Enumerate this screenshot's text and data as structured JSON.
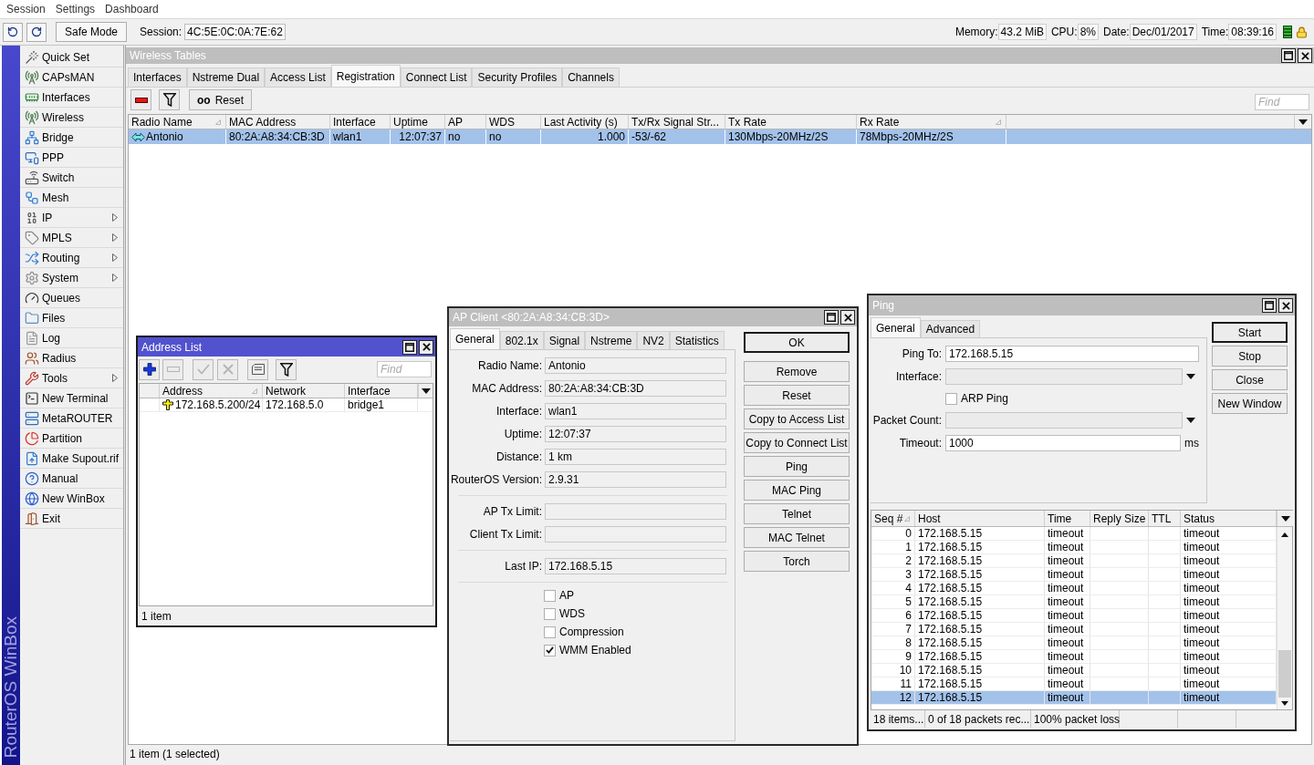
{
  "menu_bar": {
    "items": [
      "Session",
      "Settings",
      "Dashboard"
    ]
  },
  "toolbar": {
    "safe_mode": "Safe Mode",
    "session_label": "Session:",
    "session_value": "4C:5E:0C:0A:7E:62",
    "stats": [
      {
        "label": "Memory:",
        "value": "43.2 MiB"
      },
      {
        "label": "CPU:",
        "value": "8%"
      },
      {
        "label": "Date:",
        "value": "Dec/01/2017"
      },
      {
        "label": "Time:",
        "value": "08:39:16"
      }
    ]
  },
  "brand": "RouterOS WinBox",
  "sidebar": {
    "items": [
      {
        "label": "Quick Set",
        "submenu": false
      },
      {
        "label": "CAPsMAN",
        "submenu": false
      },
      {
        "label": "Interfaces",
        "submenu": false
      },
      {
        "label": "Wireless",
        "submenu": false
      },
      {
        "label": "Bridge",
        "submenu": false
      },
      {
        "label": "PPP",
        "submenu": false
      },
      {
        "label": "Switch",
        "submenu": false
      },
      {
        "label": "Mesh",
        "submenu": false
      },
      {
        "label": "IP",
        "submenu": true
      },
      {
        "label": "MPLS",
        "submenu": true
      },
      {
        "label": "Routing",
        "submenu": true
      },
      {
        "label": "System",
        "submenu": true
      },
      {
        "label": "Queues",
        "submenu": false
      },
      {
        "label": "Files",
        "submenu": false
      },
      {
        "label": "Log",
        "submenu": false
      },
      {
        "label": "Radius",
        "submenu": false
      },
      {
        "label": "Tools",
        "submenu": true
      },
      {
        "label": "New Terminal",
        "submenu": false
      },
      {
        "label": "MetaROUTER",
        "submenu": false
      },
      {
        "label": "Partition",
        "submenu": false
      },
      {
        "label": "Make Supout.rif",
        "submenu": false
      },
      {
        "label": "Manual",
        "submenu": false
      },
      {
        "label": "New WinBox",
        "submenu": false
      },
      {
        "label": "Exit",
        "submenu": false
      }
    ]
  },
  "wireless_tables": {
    "title": "Wireless Tables",
    "active": false,
    "tabs": [
      {
        "label": "Interfaces",
        "selected": false
      },
      {
        "label": "Nstreme Dual",
        "selected": false
      },
      {
        "label": "Access List",
        "selected": false
      },
      {
        "label": "Registration",
        "selected": true
      },
      {
        "label": "Connect List",
        "selected": false
      },
      {
        "label": "Security Profiles",
        "selected": false
      },
      {
        "label": "Channels",
        "selected": false
      }
    ],
    "toolbar": [
      {
        "kind": "remove",
        "disabled": false
      },
      {
        "kind": "filter",
        "disabled": false
      }
    ],
    "reset": {
      "glyph": "oo",
      "label": "Reset"
    },
    "find": {
      "placeholder": "Find"
    },
    "table": {
      "columns": [
        {
          "label": "Radio Name",
          "kind": "text",
          "sorted": true
        },
        {
          "label": "MAC Address",
          "kind": "text",
          "sorted": false
        },
        {
          "label": "Interface",
          "kind": "text",
          "sorted": false
        },
        {
          "label": "Uptime",
          "kind": "number",
          "sorted": false
        },
        {
          "label": "AP",
          "kind": "text",
          "sorted": false
        },
        {
          "label": "WDS",
          "kind": "text",
          "sorted": false
        },
        {
          "label": "Last Activity (s)",
          "kind": "number",
          "sorted": false
        },
        {
          "label": "Tx/Rx Signal Str...",
          "kind": "text",
          "sorted": false
        },
        {
          "label": "Tx Rate",
          "kind": "text",
          "sorted": false
        },
        {
          "label": "Rx Rate",
          "kind": "text",
          "sorted": true
        }
      ],
      "rows": [
        {
          "selected": true,
          "cells": [
            "Antonio",
            "80:2A:A8:34:CB:3D",
            "wlan1",
            "12:07:37",
            "no",
            "no",
            "1.000",
            "-53/-62",
            "130Mbps-20MHz/2S",
            "78Mbps-20MHz/2S"
          ]
        }
      ]
    },
    "status": "1 item (1 selected)"
  },
  "address_list": {
    "title": "Address List",
    "active": true,
    "toolbar": [
      {
        "kind": "add",
        "disabled": false
      },
      {
        "kind": "remove",
        "disabled": true
      },
      {
        "kind": "enable",
        "disabled": true
      },
      {
        "kind": "disable",
        "disabled": true
      },
      {
        "kind": "comment",
        "disabled": false
      },
      {
        "kind": "filter",
        "disabled": false
      }
    ],
    "find": {
      "placeholder": "Find"
    },
    "table": {
      "columns": [
        {
          "label": "Address",
          "sorted": true
        },
        {
          "label": "Network",
          "sorted": false
        },
        {
          "label": "Interface",
          "sorted": false
        }
      ],
      "rows": [
        {
          "selected": false,
          "cells": [
            "172.168.5.200/24",
            "172.168.5.0",
            "bridge1"
          ]
        }
      ]
    },
    "status": "1 item"
  },
  "ap_client": {
    "title": "AP Client <80:2A:A8:34:CB:3D>",
    "active": false,
    "tabs": [
      {
        "label": "General",
        "selected": true
      },
      {
        "label": "802.1x",
        "selected": false
      },
      {
        "label": "Signal",
        "selected": false
      },
      {
        "label": "Nstreme",
        "selected": false
      },
      {
        "label": "NV2",
        "selected": false
      },
      {
        "label": "Statistics",
        "selected": false
      }
    ],
    "sections": [
      {
        "fields": [
          {
            "label": "Radio Name:",
            "value": "Antonio"
          },
          {
            "label": "MAC Address:",
            "value": "80:2A:A8:34:CB:3D"
          },
          {
            "label": "Interface:",
            "value": "wlan1"
          },
          {
            "label": "Uptime:",
            "value": "12:07:37"
          },
          {
            "label": "Distance:",
            "value": "1 km"
          },
          {
            "label": "RouterOS Version:",
            "value": "2.9.31"
          }
        ]
      },
      {
        "fields": [
          {
            "label": "AP Tx Limit:"
          },
          {
            "label": "Client Tx Limit:"
          }
        ]
      },
      {
        "fields": [
          {
            "label": "Last IP:",
            "value": "172.168.5.15"
          }
        ]
      }
    ],
    "checkboxes": [
      {
        "label": "AP",
        "checked": false
      },
      {
        "label": "WDS",
        "checked": false
      },
      {
        "label": "Compression",
        "checked": false
      },
      {
        "label": "WMM Enabled",
        "checked": true
      }
    ],
    "buttons": [
      {
        "label": "OK",
        "default": true
      },
      {
        "label": "Remove",
        "default": false
      },
      {
        "label": "Reset",
        "default": false
      },
      {
        "label": "Copy to Access List",
        "default": false
      },
      {
        "label": "Copy to Connect List",
        "default": false
      },
      {
        "label": "Ping",
        "default": false
      },
      {
        "label": "MAC Ping",
        "default": false
      },
      {
        "label": "Telnet",
        "default": false
      },
      {
        "label": "MAC Telnet",
        "default": false
      },
      {
        "label": "Torch",
        "default": false
      }
    ]
  },
  "ping": {
    "title": "Ping",
    "active": false,
    "tabs": [
      {
        "label": "General",
        "selected": true
      },
      {
        "label": "Advanced",
        "selected": false
      }
    ],
    "fields": [
      {
        "kind": "text",
        "label": "Ping To:",
        "value": "172.168.5.15"
      },
      {
        "kind": "select",
        "label": "Interface:"
      },
      {
        "kind": "checkbox",
        "label": "ARP Ping",
        "checked": false
      },
      {
        "kind": "select",
        "label": "Packet Count:"
      },
      {
        "kind": "text",
        "label": "Timeout:",
        "value": "1000",
        "unit": "ms"
      }
    ],
    "buttons": [
      {
        "label": "Start",
        "default": true
      },
      {
        "label": "Stop",
        "default": false
      },
      {
        "label": "Close",
        "default": false
      },
      {
        "label": "New Window",
        "default": false
      }
    ],
    "table": {
      "columns": [
        {
          "label": "Seq #",
          "kind": "number",
          "sorted": true
        },
        {
          "label": "Host",
          "kind": "text",
          "sorted": false
        },
        {
          "label": "Time",
          "kind": "text",
          "sorted": false
        },
        {
          "label": "Reply Size",
          "kind": "text",
          "sorted": false
        },
        {
          "label": "TTL",
          "kind": "text",
          "sorted": false
        },
        {
          "label": "Status",
          "kind": "text",
          "sorted": false
        }
      ],
      "rows": [
        {
          "seq": "0",
          "host": "172.168.5.15",
          "time": "timeout",
          "status": "timeout",
          "selected": false
        },
        {
          "seq": "1",
          "host": "172.168.5.15",
          "time": "timeout",
          "status": "timeout",
          "selected": false
        },
        {
          "seq": "2",
          "host": "172.168.5.15",
          "time": "timeout",
          "status": "timeout",
          "selected": false
        },
        {
          "seq": "3",
          "host": "172.168.5.15",
          "time": "timeout",
          "status": "timeout",
          "selected": false
        },
        {
          "seq": "4",
          "host": "172.168.5.15",
          "time": "timeout",
          "status": "timeout",
          "selected": false
        },
        {
          "seq": "5",
          "host": "172.168.5.15",
          "time": "timeout",
          "status": "timeout",
          "selected": false
        },
        {
          "seq": "6",
          "host": "172.168.5.15",
          "time": "timeout",
          "status": "timeout",
          "selected": false
        },
        {
          "seq": "7",
          "host": "172.168.5.15",
          "time": "timeout",
          "status": "timeout",
          "selected": false
        },
        {
          "seq": "8",
          "host": "172.168.5.15",
          "time": "timeout",
          "status": "timeout",
          "selected": false
        },
        {
          "seq": "9",
          "host": "172.168.5.15",
          "time": "timeout",
          "status": "timeout",
          "selected": false
        },
        {
          "seq": "10",
          "host": "172.168.5.15",
          "time": "timeout",
          "status": "timeout",
          "selected": false
        },
        {
          "seq": "11",
          "host": "172.168.5.15",
          "time": "timeout",
          "status": "timeout",
          "selected": false
        },
        {
          "seq": "12",
          "host": "172.168.5.15",
          "time": "timeout",
          "status": "timeout",
          "selected": true
        }
      ]
    },
    "status": [
      "18 items...",
      "0 of 18 packets rec...",
      "100% packet loss"
    ]
  }
}
